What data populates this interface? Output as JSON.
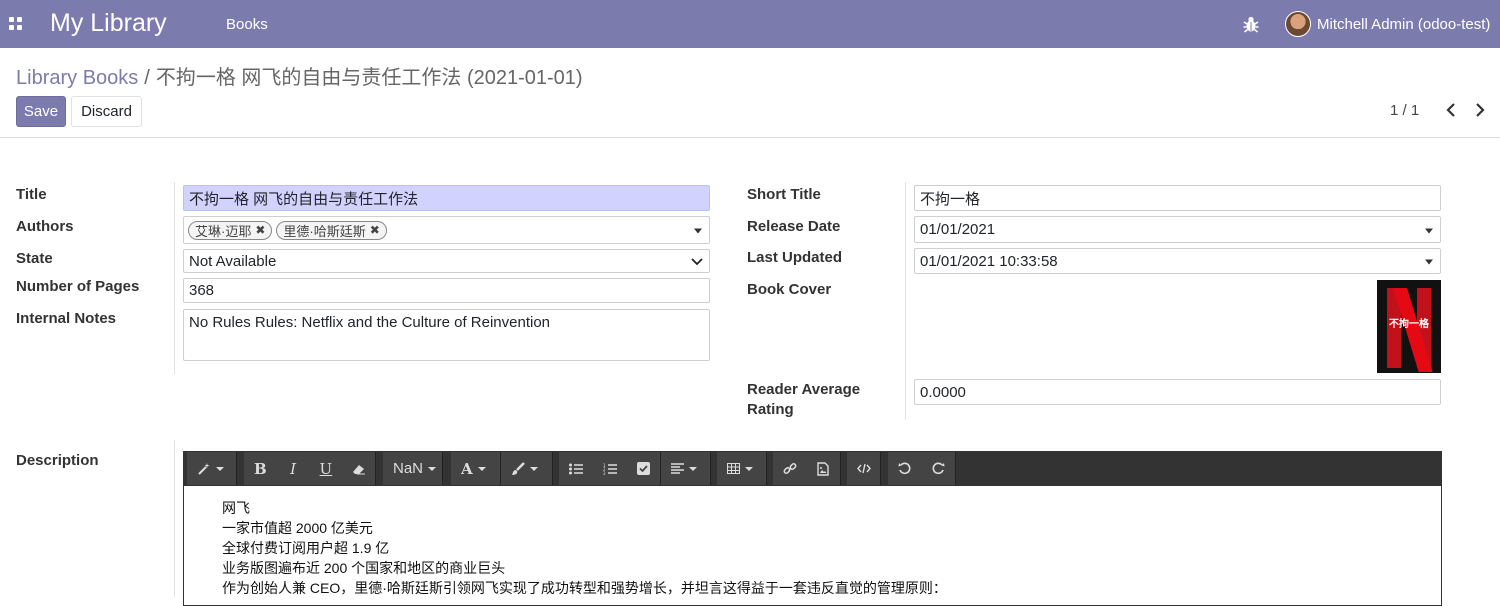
{
  "navbar": {
    "app_title": "My Library",
    "menu_books": "Books",
    "user_name": "Mitchell Admin (odoo-test)",
    "color": "#7c7bad"
  },
  "control_panel": {
    "breadcrumb_parent": "Library Books",
    "breadcrumb_separator": "/",
    "breadcrumb_current": "不拘一格 网飞的自由与责任工作法 (2021-01-01)",
    "save_label": "Save",
    "discard_label": "Discard",
    "pager": "1 / 1"
  },
  "form": {
    "left": {
      "title_label": "Title",
      "title_value": "不拘一格 网飞的自由与责任工作法",
      "authors_label": "Authors",
      "authors": [
        "艾琳·迈耶",
        "里德·哈斯廷斯"
      ],
      "state_label": "State",
      "state_value": "Not Available",
      "pages_label": "Number of Pages",
      "pages_value": "368",
      "notes_label": "Internal Notes",
      "notes_value": "No Rules Rules: Netflix and the Culture of Reinvention"
    },
    "right": {
      "short_title_label": "Short Title",
      "short_title_value": "不拘一格",
      "release_date_label": "Release Date",
      "release_date_value": "01/01/2021",
      "last_updated_label": "Last Updated",
      "last_updated_value": "01/01/2021 10:33:58",
      "cover_label": "Book Cover",
      "cover_title": "不拘一格",
      "rating_label_line1": "Reader Average",
      "rating_label_line2": "Rating",
      "rating_value": "0.0000"
    },
    "description_label": "Description",
    "toolbar": {
      "font_size_label": "NaN"
    },
    "description_lines": [
      "网飞",
      "一家市值超 2000 亿美元",
      "全球付费订阅用户超 1.9 亿",
      "业务版图遍布近 200 个国家和地区的商业巨头",
      "作为创始人兼 CEO，里德·哈斯廷斯引领网飞实现了成功转型和强势增长，并坦言这得益于一套违反直觉的管理原则："
    ]
  }
}
